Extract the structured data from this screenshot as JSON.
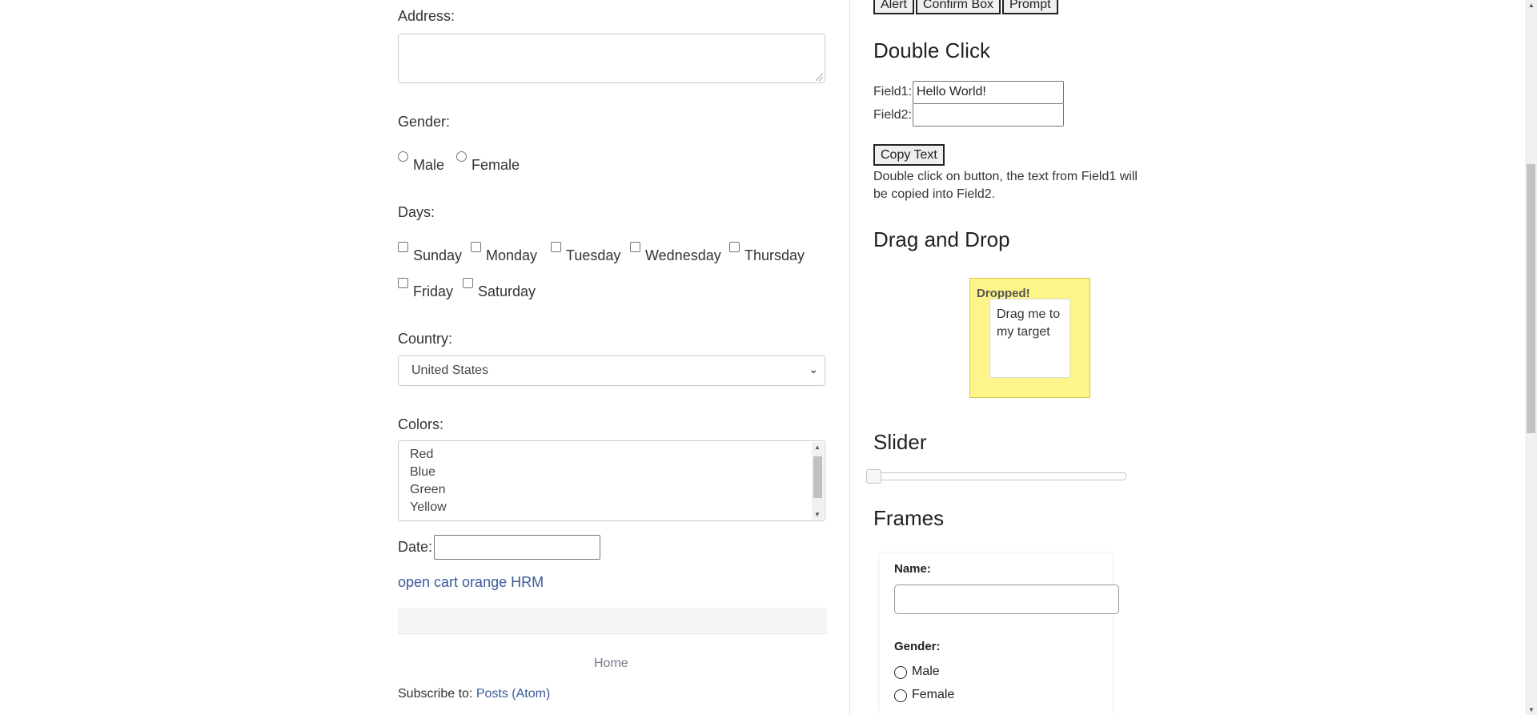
{
  "form": {
    "address_label": "Address:",
    "gender_label": "Gender:",
    "gender_options": [
      "Male",
      "Female"
    ],
    "days_label": "Days:",
    "days": [
      "Sunday",
      "Monday",
      "Tuesday",
      "Wednesday",
      "Thursday",
      "Friday",
      "Saturday"
    ],
    "country_label": "Country:",
    "country_value": "United States",
    "colors_label": "Colors:",
    "colors": [
      "Red",
      "Blue",
      "Green",
      "Yellow"
    ],
    "date_label": "Date:",
    "link_text": "open cart orange HRM",
    "home_link": "Home",
    "subscribe_label": "Subscribe to:",
    "subscribe_link": "Posts (Atom)"
  },
  "alerts": {
    "buttons": [
      "Alert",
      "Confirm Box",
      "Prompt"
    ]
  },
  "double_click": {
    "title": "Double Click",
    "field1_label": "Field1:",
    "field1_value": "Hello World!",
    "field2_label": "Field2:",
    "field2_value": "",
    "button": "Copy Text",
    "note": "Double click on button, the text from Field1 will be copied into Field2."
  },
  "drag_drop": {
    "title": "Drag and Drop",
    "drop_text": "Dropped!",
    "drag_text": "Drag me to my target"
  },
  "slider": {
    "title": "Slider",
    "value_fraction": 0
  },
  "frames": {
    "title": "Frames",
    "name_label": "Name:",
    "gender_label": "Gender:",
    "gender_options": [
      "Male",
      "Female"
    ]
  },
  "icons": {
    "select_chevron": "chevron-down-icon",
    "scroll_up": "triangle-up",
    "scroll_down": "triangle-down"
  }
}
